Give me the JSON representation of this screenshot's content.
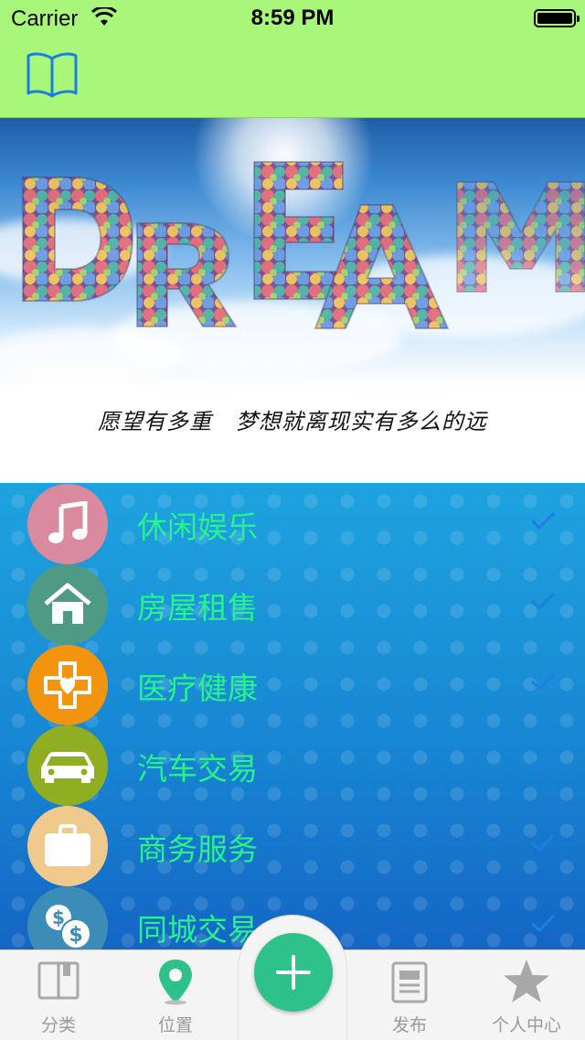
{
  "status_bar": {
    "carrier": "Carrier",
    "time": "8:59 PM"
  },
  "nav_bar": {
    "left_icon": "book-icon",
    "color": "#a8f77a"
  },
  "banner": {
    "logo_text": "DREAM",
    "slogan": "愿望有多重   梦想就离现实有多么的远"
  },
  "categories": [
    {
      "label": "休闲娱乐",
      "icon": "music-note-icon",
      "color": "#d98a9e"
    },
    {
      "label": "房屋租售",
      "icon": "house-icon",
      "color": "#4f9a84"
    },
    {
      "label": "医疗健康",
      "icon": "medical-cross-icon",
      "color": "#f2940e"
    },
    {
      "label": "汽车交易",
      "icon": "car-icon",
      "color": "#8fae22"
    },
    {
      "label": "商务服务",
      "icon": "briefcase-icon",
      "color": "#f0c98c"
    },
    {
      "label": "同城交易",
      "icon": "money-exchange-icon",
      "color": "#3b8db8"
    }
  ],
  "list_label_color": "#28f28c",
  "tab_bar": {
    "tabs": [
      {
        "label": "分类",
        "icon": "category-book-icon"
      },
      {
        "label": "位置",
        "icon": "location-pin-icon"
      },
      {
        "label": "",
        "icon": "add-icon"
      },
      {
        "label": "发布",
        "icon": "document-icon"
      },
      {
        "label": "个人中心",
        "icon": "star-icon"
      }
    ],
    "add_button_color": "#2ec28a"
  }
}
